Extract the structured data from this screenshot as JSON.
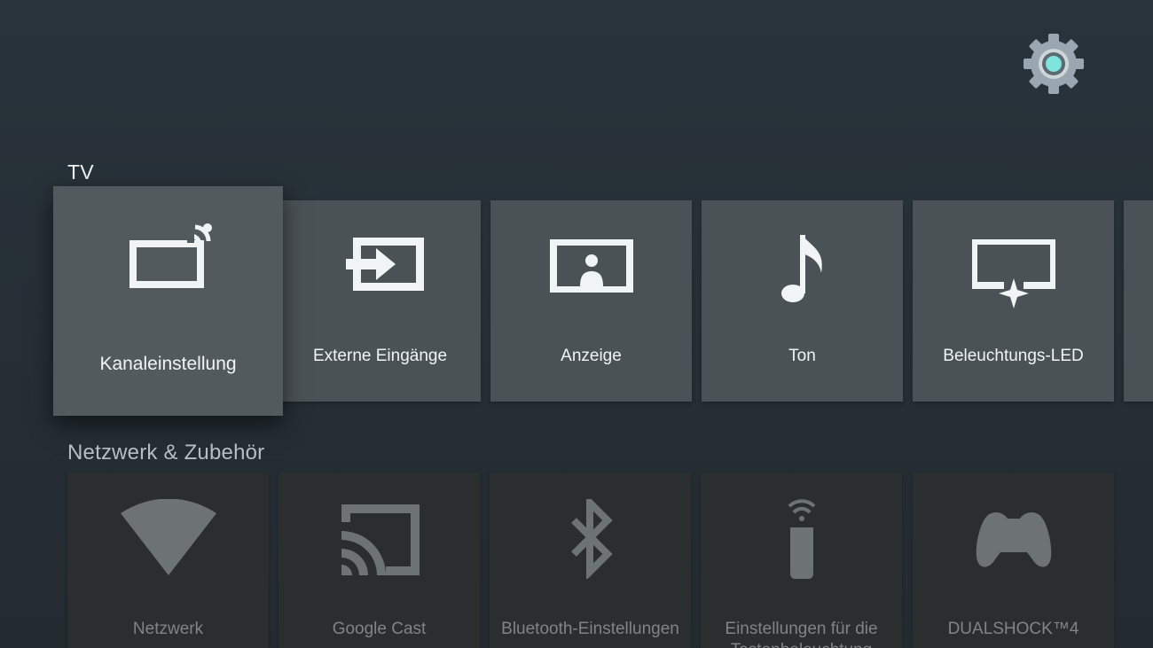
{
  "header": {
    "settings_icon": "settings-gear-icon"
  },
  "sections": {
    "tv": {
      "title": "TV",
      "cards": [
        {
          "label": "Kanaleinstellung",
          "icon": "tv-broadcast-icon"
        },
        {
          "label": "Externe Eingänge",
          "icon": "input-icon"
        },
        {
          "label": "Anzeige",
          "icon": "picture-icon"
        },
        {
          "label": "Ton",
          "icon": "music-note-icon"
        },
        {
          "label": "Beleuchtungs-LED",
          "icon": "illumination-led-icon"
        }
      ]
    },
    "network": {
      "title": "Netzwerk & Zubehör",
      "cards": [
        {
          "label": "Netzwerk",
          "icon": "wifi-icon"
        },
        {
          "label": "Google Cast",
          "icon": "cast-icon"
        },
        {
          "label": "Bluetooth-Einstellungen",
          "icon": "bluetooth-icon"
        },
        {
          "label": "Einstellungen für die Tastenbeleuchtung",
          "icon": "remote-icon"
        },
        {
          "label": "DUALSHOCK™4",
          "icon": "gamepad-icon"
        }
      ]
    }
  },
  "colors": {
    "background": "#263037",
    "card": "#4b5256",
    "card_dim": "#2b2e2f",
    "gear_accent": "#7fe3de"
  }
}
